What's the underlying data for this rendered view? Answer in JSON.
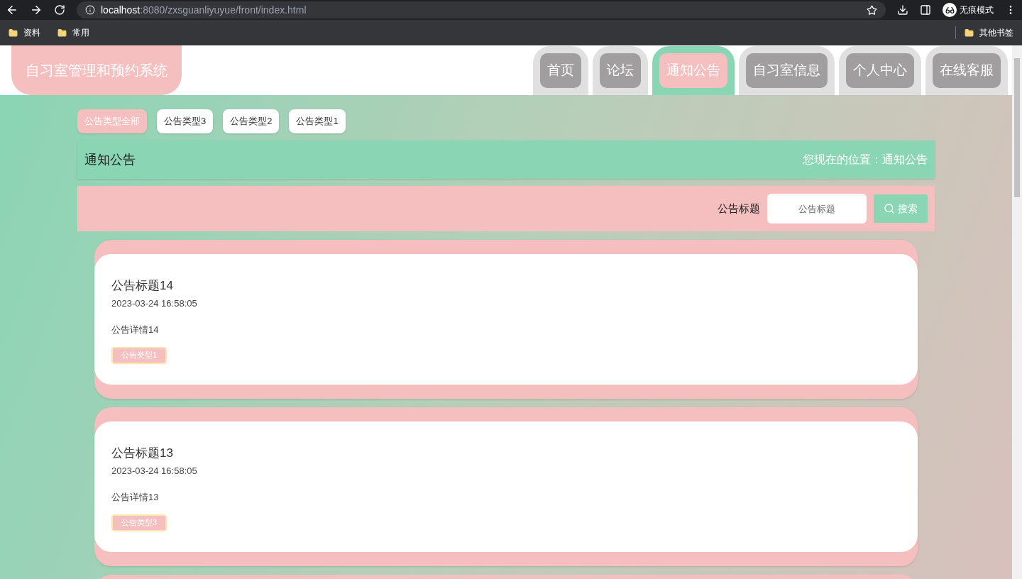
{
  "browser": {
    "address_host": "localhost",
    "address_rest": ":8080/zxsguanliyuyue/front/index.html",
    "profile": "无痕模式",
    "bookmarks": [
      "资料",
      "常用"
    ],
    "other_bookmarks": "其他书签"
  },
  "header": {
    "logo": "自习室管理和预约系统",
    "nav": [
      {
        "label": "首页",
        "selected": false
      },
      {
        "label": "论坛",
        "selected": false
      },
      {
        "label": "通知公告",
        "selected": true
      },
      {
        "label": "自习室信息",
        "selected": false
      },
      {
        "label": "个人中心",
        "selected": false
      },
      {
        "label": "在线客服",
        "selected": false
      }
    ]
  },
  "filters": [
    {
      "label": "公告类型全部",
      "selected": true
    },
    {
      "label": "公告类型3",
      "selected": false
    },
    {
      "label": "公告类型2",
      "selected": false
    },
    {
      "label": "公告类型1",
      "selected": false
    }
  ],
  "title_bar": {
    "title": "通知公告",
    "breadcrumb": "您现在的位置：通知公告"
  },
  "search": {
    "label": "公告标题",
    "placeholder": "公告标题",
    "button": "搜索"
  },
  "notices": [
    {
      "title": "公告标题14",
      "time": "2023-03-24 16:58:05",
      "detail": "公告详情14",
      "tag": "公告类型1"
    },
    {
      "title": "公告标题13",
      "time": "2023-03-24 16:58:05",
      "detail": "公告详情13",
      "tag": "公告类型3"
    }
  ]
}
